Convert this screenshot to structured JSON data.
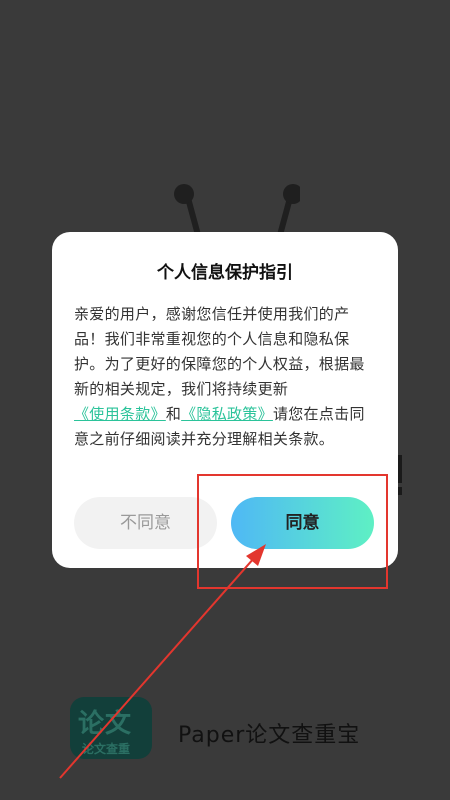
{
  "background": {
    "exclaim": "!",
    "brand": {
      "logo_mark": "论文",
      "logo_sub": "论文查重",
      "name": "Paper论文查重宝"
    }
  },
  "dialog": {
    "title": "个人信息保护指引",
    "body_before_terms": "亲爱的用户，感谢您信任并使用我们的产品！我们非常重视您的个人信息和隐私保护。为了更好的保障您的个人权益，根据最新的相关规定，我们将持续更新",
    "terms_link": "《使用条款》",
    "and_text": "和",
    "privacy_link": "《隐私政策》",
    "body_after_links": "请您在点击同意之前仔细阅读并充分理解相关条款。",
    "decline_label": "不同意",
    "agree_label": "同意"
  },
  "colors": {
    "overlay": "#3a3a3a",
    "link": "#2bc39a",
    "agree_gradient_start": "#4fb8f5",
    "agree_gradient_end": "#5ef0c4",
    "annotation": "#e3362e"
  }
}
